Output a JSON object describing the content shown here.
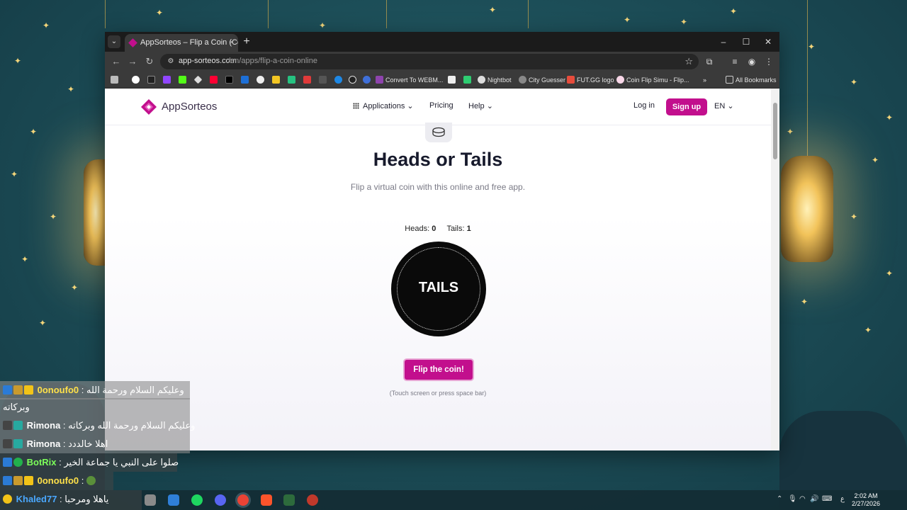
{
  "browser": {
    "tab_title": "AppSorteos – Flip a Coin (Coin",
    "tab_close": "×",
    "new_tab": "+",
    "url_host": "app-sorteos.com",
    "url_path": "/en/apps/flip-a-coin-online",
    "window_controls": [
      "–",
      "☐",
      "✕"
    ],
    "bookmarks": [
      "Convert To WEBM...",
      "Nightbot",
      "City Guesser",
      "FUT.GG logo",
      "Coin Flip Simu - Flip..."
    ],
    "all_bookmarks": "All Bookmarks",
    "bookmarks_more": "»"
  },
  "site": {
    "logo_text": "AppSorteos",
    "nav": {
      "applications": "Applications",
      "pricing": "Pricing",
      "help": "Help",
      "login": "Log in",
      "signup": "Sign up",
      "language": "EN"
    },
    "brand_color": "#c20f8d"
  },
  "main": {
    "title": "Heads or Tails",
    "subtitle": "Flip a virtual coin with this online and free app.",
    "heads_label": "Heads:",
    "heads_count": "0",
    "tails_label": "Tails:",
    "tails_count": "1",
    "coin_face": "TAILS",
    "flip_button": "Flip the coin!",
    "hint": "(Touch screen or press space bar)"
  },
  "chat": [
    {
      "user": "0onoufo0",
      "message": "وعليكم السلام ورحمة الله",
      "message_cont": "وبركاته",
      "name_color": "#ffe14a"
    },
    {
      "user": "Rimona",
      "message": "وعليكم السلام ورحمة الله وبركاته",
      "name_color": "#ffffff"
    },
    {
      "user": "Rimona",
      "message": "اهلا خالددد",
      "name_color": "#ffffff"
    },
    {
      "user": "BotRix",
      "message": "صلوا على النبي يا جماعة الخير",
      "name_color": "#7cff5a"
    },
    {
      "user": "0onoufo0",
      "message": "",
      "name_color": "#ffe14a"
    },
    {
      "user": "Khaled77",
      "message": "ياهلا ومرحبا",
      "name_color": "#4aa8ff"
    }
  ],
  "taskbar": {
    "time": "2:02 AM",
    "date": "2/27/2026",
    "lang": "ع"
  }
}
